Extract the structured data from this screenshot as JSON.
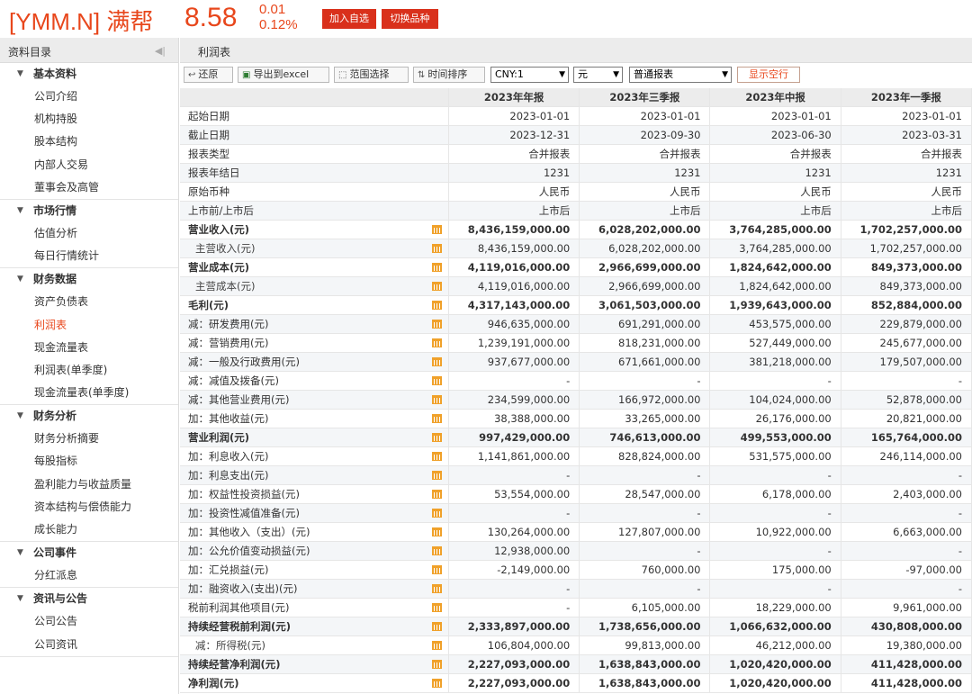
{
  "header": {
    "stock_name": "[YMM.N] 满帮",
    "price": "8.58",
    "change_abs": "0.01",
    "change_pct": "0.12%",
    "add_watchlist": "加入自选",
    "switch_symbol": "切换品种",
    "accent_color": "#e8471c",
    "button_color": "#d9301b"
  },
  "sidebar": {
    "title": "资料目录",
    "collapse_icon": "collapse-left-icon",
    "groups": [
      {
        "title": "基本资料",
        "items": [
          "公司介绍",
          "机构持股",
          "股本结构",
          "内部人交易",
          "董事会及高管"
        ]
      },
      {
        "title": "市场行情",
        "items": [
          "估值分析",
          "每日行情统计"
        ]
      },
      {
        "title": "财务数据",
        "items": [
          "资产负债表",
          "利润表",
          "现金流量表",
          "利润表(单季度)",
          "现金流量表(单季度)"
        ]
      },
      {
        "title": "财务分析",
        "items": [
          "财务分析摘要",
          "每股指标",
          "盈利能力与收益质量",
          "资本结构与偿债能力",
          "成长能力"
        ]
      },
      {
        "title": "公司事件",
        "items": [
          "分红派息"
        ]
      },
      {
        "title": "资讯与公告",
        "items": [
          "公司公告",
          "公司资讯"
        ]
      }
    ],
    "active_item": "利润表"
  },
  "main": {
    "title": "利润表",
    "toolbar": {
      "restore": "还原",
      "export": "导出到excel",
      "range_select": "范围选择",
      "time_sort": "时间排序",
      "currency": "CNY:1",
      "unit": "元",
      "report_type": "普通报表",
      "show_empty": "显示空行"
    },
    "columns": [
      "2023年年报",
      "2023年三季报",
      "2023年中报",
      "2023年一季报"
    ],
    "rows": [
      {
        "label": "起始日期",
        "values": [
          "2023-01-01",
          "2023-01-01",
          "2023-01-01",
          "2023-01-01"
        ]
      },
      {
        "label": "截止日期",
        "values": [
          "2023-12-31",
          "2023-09-30",
          "2023-06-30",
          "2023-03-31"
        ]
      },
      {
        "label": "报表类型",
        "values": [
          "合并报表",
          "合并报表",
          "合并报表",
          "合并报表"
        ]
      },
      {
        "label": "报表年结日",
        "values": [
          "1231",
          "1231",
          "1231",
          "1231"
        ]
      },
      {
        "label": "原始币种",
        "values": [
          "人民币",
          "人民币",
          "人民币",
          "人民币"
        ]
      },
      {
        "label": "上市前/上市后",
        "values": [
          "上市后",
          "上市后",
          "上市后",
          "上市后"
        ]
      },
      {
        "label": "营业收入(元)",
        "bold": true,
        "chart": true,
        "values": [
          "8,436,159,000.00",
          "6,028,202,000.00",
          "3,764,285,000.00",
          "1,702,257,000.00"
        ]
      },
      {
        "label": "主营收入(元)",
        "indent": true,
        "chart": true,
        "values": [
          "8,436,159,000.00",
          "6,028,202,000.00",
          "3,764,285,000.00",
          "1,702,257,000.00"
        ]
      },
      {
        "label": "营业成本(元)",
        "bold": true,
        "chart": true,
        "values": [
          "4,119,016,000.00",
          "2,966,699,000.00",
          "1,824,642,000.00",
          "849,373,000.00"
        ]
      },
      {
        "label": "主营成本(元)",
        "indent": true,
        "chart": true,
        "values": [
          "4,119,016,000.00",
          "2,966,699,000.00",
          "1,824,642,000.00",
          "849,373,000.00"
        ]
      },
      {
        "label": "毛利(元)",
        "bold": true,
        "chart": true,
        "values": [
          "4,317,143,000.00",
          "3,061,503,000.00",
          "1,939,643,000.00",
          "852,884,000.00"
        ]
      },
      {
        "label": "减：研发费用(元)",
        "chart": true,
        "values": [
          "946,635,000.00",
          "691,291,000.00",
          "453,575,000.00",
          "229,879,000.00"
        ]
      },
      {
        "label": "减：营销费用(元)",
        "chart": true,
        "values": [
          "1,239,191,000.00",
          "818,231,000.00",
          "527,449,000.00",
          "245,677,000.00"
        ]
      },
      {
        "label": "减：一般及行政费用(元)",
        "chart": true,
        "values": [
          "937,677,000.00",
          "671,661,000.00",
          "381,218,000.00",
          "179,507,000.00"
        ]
      },
      {
        "label": "减：减值及拨备(元)",
        "chart": true,
        "values": [
          "-",
          "-",
          "-",
          "-"
        ]
      },
      {
        "label": "减：其他营业费用(元)",
        "chart": true,
        "values": [
          "234,599,000.00",
          "166,972,000.00",
          "104,024,000.00",
          "52,878,000.00"
        ]
      },
      {
        "label": "加：其他收益(元)",
        "chart": true,
        "values": [
          "38,388,000.00",
          "33,265,000.00",
          "26,176,000.00",
          "20,821,000.00"
        ]
      },
      {
        "label": "营业利润(元)",
        "bold": true,
        "chart": true,
        "values": [
          "997,429,000.00",
          "746,613,000.00",
          "499,553,000.00",
          "165,764,000.00"
        ]
      },
      {
        "label": "加：利息收入(元)",
        "chart": true,
        "values": [
          "1,141,861,000.00",
          "828,824,000.00",
          "531,575,000.00",
          "246,114,000.00"
        ]
      },
      {
        "label": "加：利息支出(元)",
        "chart": true,
        "values": [
          "-",
          "-",
          "-",
          "-"
        ]
      },
      {
        "label": "加：权益性投资损益(元)",
        "chart": true,
        "values": [
          "53,554,000.00",
          "28,547,000.00",
          "6,178,000.00",
          "2,403,000.00"
        ]
      },
      {
        "label": "加：投资性减值准备(元)",
        "chart": true,
        "values": [
          "-",
          "-",
          "-",
          "-"
        ]
      },
      {
        "label": "加：其他收入（支出）(元)",
        "chart": true,
        "values": [
          "130,264,000.00",
          "127,807,000.00",
          "10,922,000.00",
          "6,663,000.00"
        ]
      },
      {
        "label": "加：公允价值变动损益(元)",
        "chart": true,
        "values": [
          "12,938,000.00",
          "-",
          "-",
          "-"
        ]
      },
      {
        "label": "加：汇兑损益(元)",
        "chart": true,
        "values": [
          "-2,149,000.00",
          "760,000.00",
          "175,000.00",
          "-97,000.00"
        ]
      },
      {
        "label": "加：融资收入(支出)(元)",
        "chart": true,
        "values": [
          "-",
          "-",
          "-",
          "-"
        ]
      },
      {
        "label": "税前利润其他项目(元)",
        "chart": true,
        "values": [
          "-",
          "6,105,000.00",
          "18,229,000.00",
          "9,961,000.00"
        ]
      },
      {
        "label": "持续经营税前利润(元)",
        "bold": true,
        "chart": true,
        "values": [
          "2,333,897,000.00",
          "1,738,656,000.00",
          "1,066,632,000.00",
          "430,808,000.00"
        ]
      },
      {
        "label": "减：所得税(元)",
        "indent": true,
        "chart": true,
        "values": [
          "106,804,000.00",
          "99,813,000.00",
          "46,212,000.00",
          "19,380,000.00"
        ]
      },
      {
        "label": "持续经营净利润(元)",
        "bold": true,
        "chart": true,
        "values": [
          "2,227,093,000.00",
          "1,638,843,000.00",
          "1,020,420,000.00",
          "411,428,000.00"
        ]
      },
      {
        "label": "净利润(元)",
        "bold": true,
        "chart": true,
        "values": [
          "2,227,093,000.00",
          "1,638,843,000.00",
          "1,020,420,000.00",
          "411,428,000.00"
        ]
      }
    ]
  }
}
